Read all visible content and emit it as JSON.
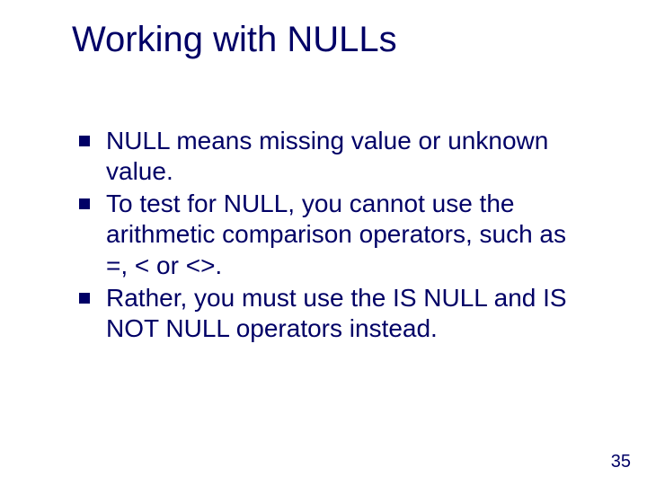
{
  "slide": {
    "title": "Working with NULLs",
    "bullets": [
      "NULL means missing value or unknown value.",
      "To test for NULL, you cannot use the arithmetic comparison operators, such as =, < or <>.",
      "Rather, you must use the IS NULL and IS NOT NULL operators instead."
    ],
    "page_number": "35"
  }
}
